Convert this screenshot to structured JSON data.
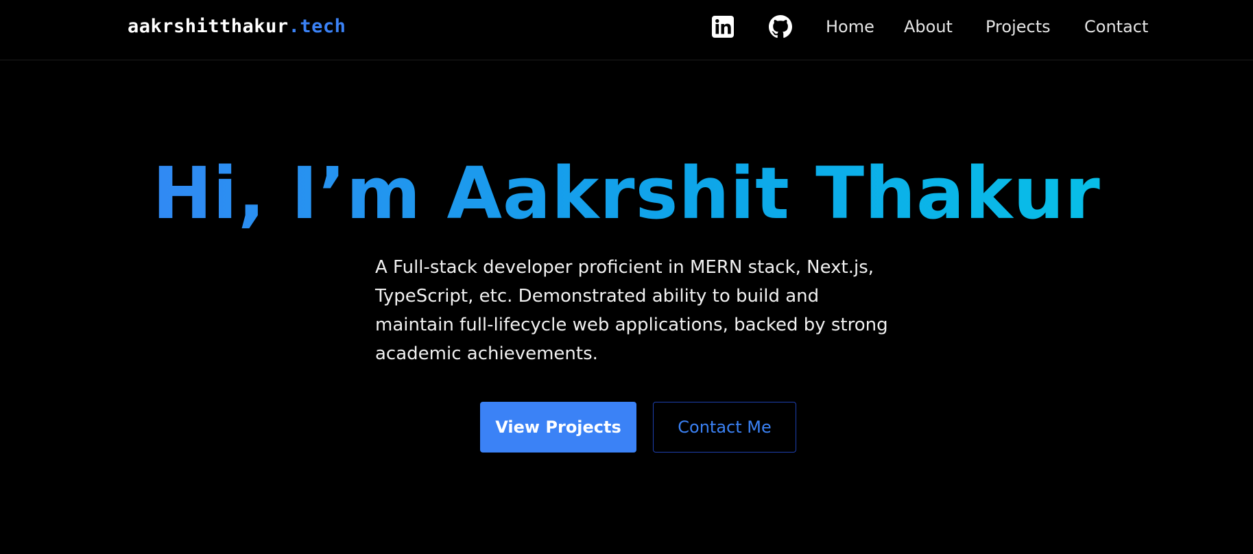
{
  "header": {
    "logo_main": "aakrshitthakur",
    "logo_accent": ".tech",
    "social": [
      {
        "icon": "linkedin-icon"
      },
      {
        "icon": "github-icon"
      }
    ],
    "nav": [
      "Home",
      "About",
      "Projects",
      "Contact"
    ]
  },
  "hero": {
    "title": "Hi, I’m Aakrshit Thakur",
    "description_lines": [
      "A Full-stack developer proficient in MERN stack, Next.js,",
      "TypeScript, etc. Demonstrated ability to build and",
      "maintain full-lifecycle web applications, backed by strong",
      "academic achievements."
    ],
    "primary_button": "View Projects",
    "secondary_button": "Contact Me"
  },
  "colors": {
    "background": "#000000",
    "accent": "#3b82f6",
    "gradient_start": "#3b82f6",
    "gradient_end": "#06c8e8"
  }
}
